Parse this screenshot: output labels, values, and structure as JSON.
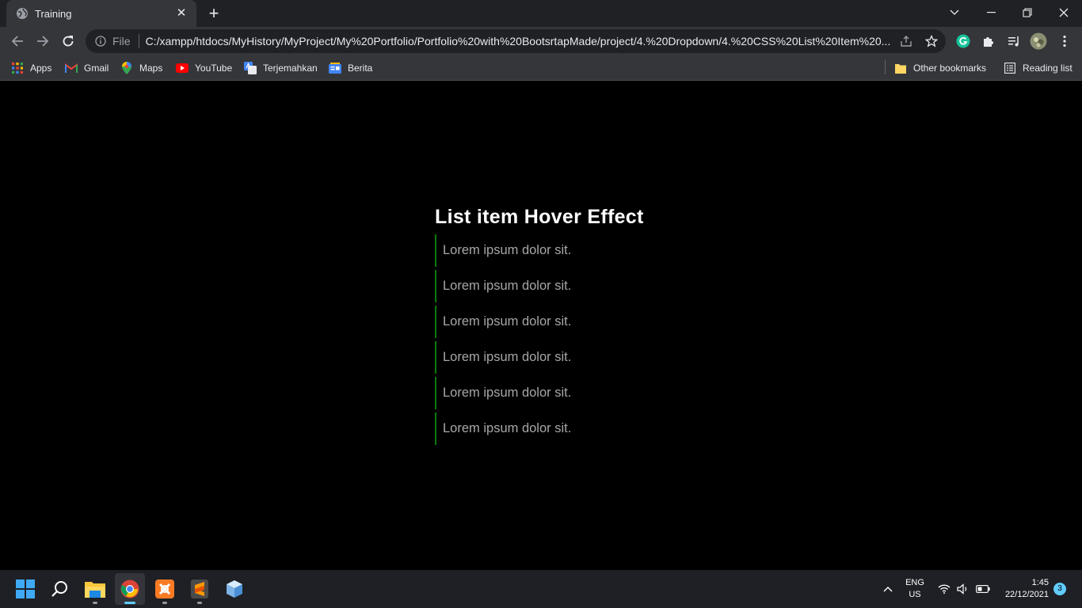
{
  "browser": {
    "tab": {
      "title": "Training",
      "close_glyph": "✕",
      "favicon": "globe-icon"
    },
    "new_tab_glyph": "+",
    "omnibox": {
      "scheme": "File",
      "url": "C:/xampp/htdocs/MyHistory/MyProject/My%20Portfolio/Portfolio%20with%20BootsrtapMade/project/4.%20Dropdown/4.%20CSS%20List%20Item%20..."
    },
    "bookmarks": [
      {
        "label": "Apps",
        "icon": "apps-grid-icon"
      },
      {
        "label": "Gmail",
        "icon": "gmail-icon"
      },
      {
        "label": "Maps",
        "icon": "maps-icon"
      },
      {
        "label": "YouTube",
        "icon": "youtube-icon"
      },
      {
        "label": "Terjemahkan",
        "icon": "translate-icon"
      },
      {
        "label": "Berita",
        "icon": "news-icon"
      }
    ],
    "other_bookmarks": "Other bookmarks",
    "reading_list": "Reading list"
  },
  "page": {
    "heading": "List item Hover Effect",
    "items": [
      "Lorem ipsum dolor sit.",
      "Lorem ipsum dolor sit.",
      "Lorem ipsum dolor sit.",
      "Lorem ipsum dolor sit.",
      "Lorem ipsum dolor sit.",
      "Lorem ipsum dolor sit."
    ],
    "accent_color": "#0a7a0a"
  },
  "taskbar": {
    "apps": [
      "start",
      "search",
      "file-explorer",
      "chrome",
      "xampp",
      "sublime-text",
      "cube-app"
    ],
    "language": {
      "line1": "ENG",
      "line2": "US"
    },
    "clock": {
      "time": "1:45",
      "date": "22/12/2021"
    },
    "notifications": "3"
  }
}
